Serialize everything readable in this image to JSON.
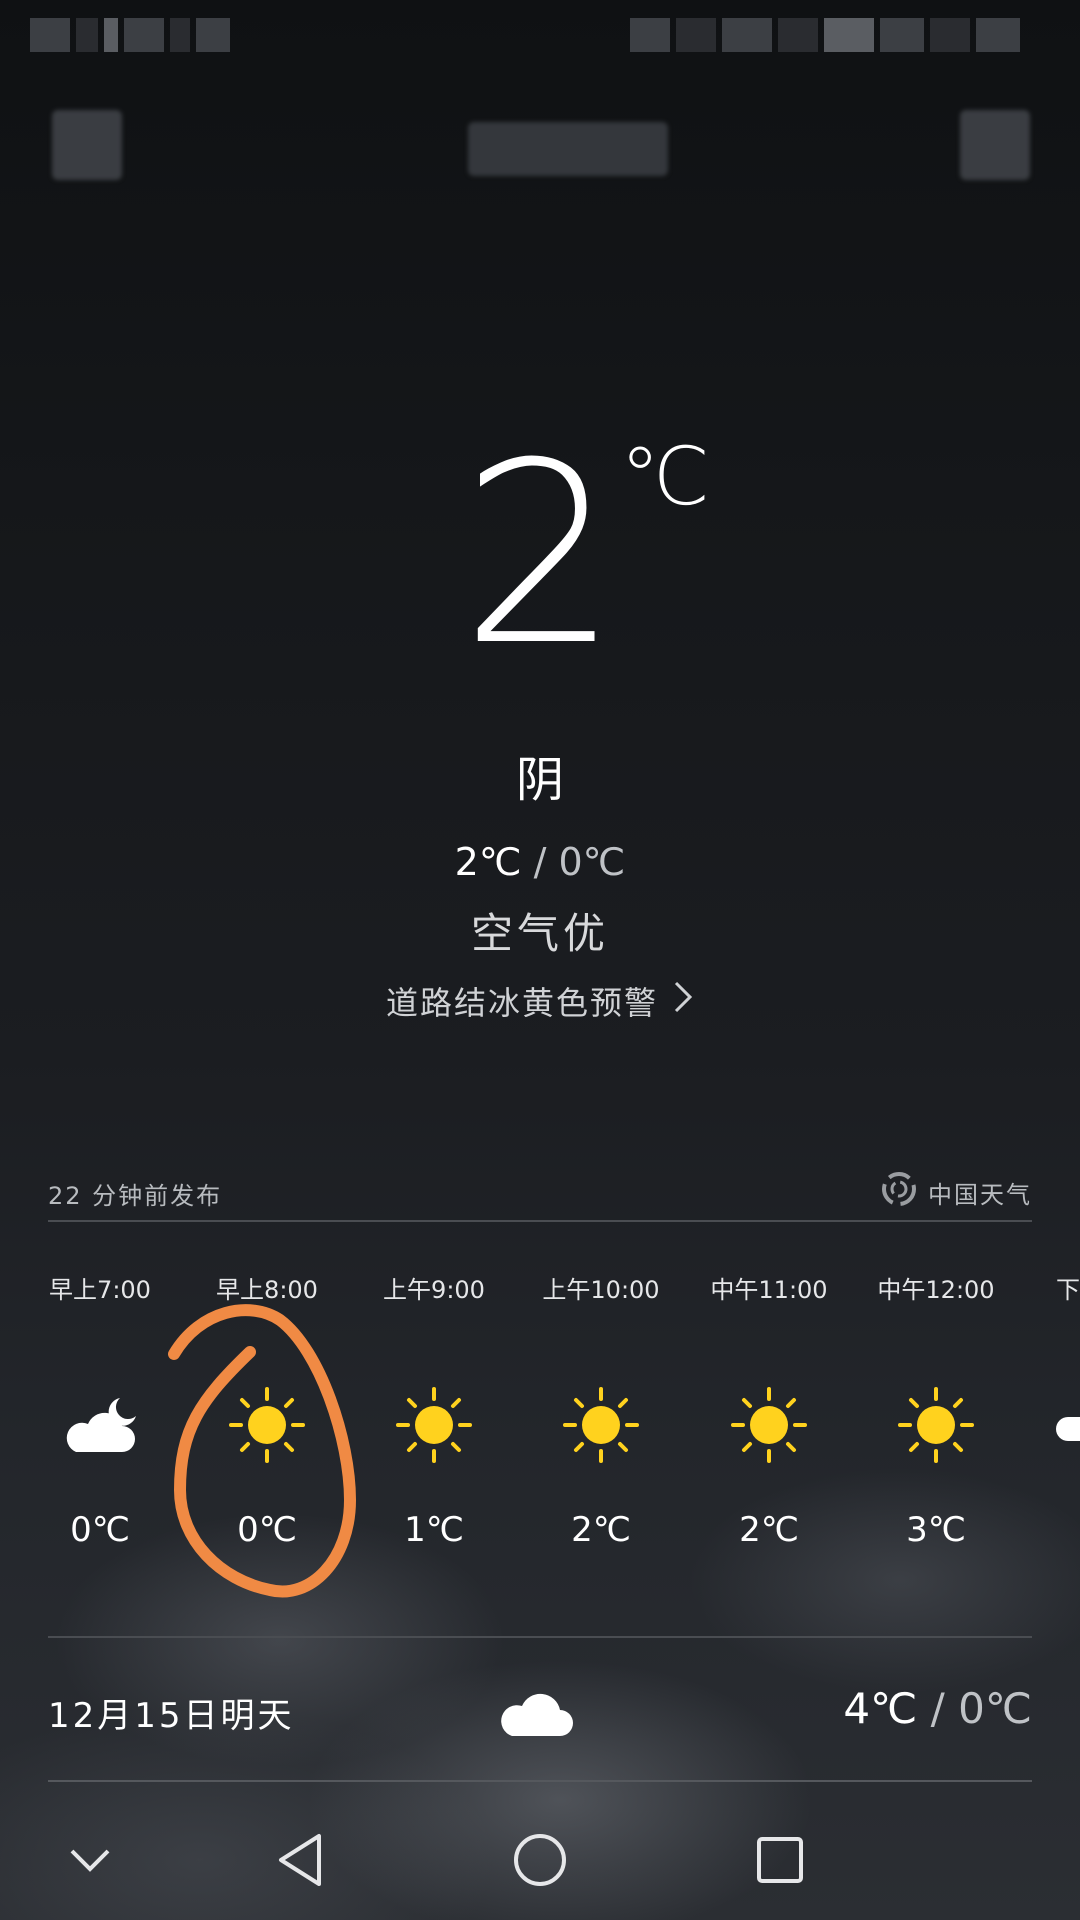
{
  "main": {
    "temperature": "2",
    "unit": "℃",
    "condition": "阴",
    "temp_high": "2℃",
    "temp_sep": " / ",
    "temp_low": "0℃",
    "air_quality": "空气优",
    "alert": "道路结冰黄色预警"
  },
  "publish": {
    "time_text": "22 分钟前发布",
    "source": "中国天气"
  },
  "hourly": [
    {
      "time": "早上7:00",
      "icon": "cloudy-night-icon",
      "temp": "0℃"
    },
    {
      "time": "早上8:00",
      "icon": "sun-icon",
      "temp": "0℃"
    },
    {
      "time": "上午9:00",
      "icon": "sun-icon",
      "temp": "1℃"
    },
    {
      "time": "上午10:00",
      "icon": "sun-icon",
      "temp": "2℃"
    },
    {
      "time": "中午11:00",
      "icon": "sun-icon",
      "temp": "2℃"
    },
    {
      "time": "中午12:00",
      "icon": "sun-icon",
      "temp": "3℃"
    },
    {
      "time": "下",
      "icon": "cloud-icon",
      "temp": ""
    }
  ],
  "tomorrow": {
    "date": "12月15日明天",
    "icon": "cloud-icon",
    "high": "4℃",
    "sep": " / ",
    "low": "0℃"
  },
  "colors": {
    "sun": "#FFD21E",
    "annotation": "#F08A44"
  }
}
